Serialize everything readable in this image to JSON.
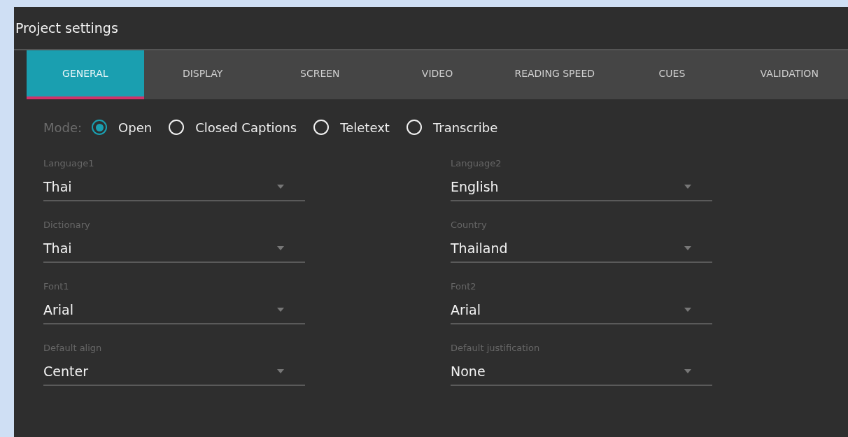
{
  "window": {
    "title": "Project settings"
  },
  "tabs": [
    {
      "label": "GENERAL",
      "selected": true
    },
    {
      "label": "DISPLAY",
      "selected": false
    },
    {
      "label": "SCREEN",
      "selected": false
    },
    {
      "label": "VIDEO",
      "selected": false
    },
    {
      "label": "READING SPEED",
      "selected": false
    },
    {
      "label": "CUES",
      "selected": false
    },
    {
      "label": "VALIDATION",
      "selected": false
    }
  ],
  "mode": {
    "label": "Mode:",
    "options": [
      {
        "label": "Open",
        "selected": true
      },
      {
        "label": "Closed Captions",
        "selected": false
      },
      {
        "label": "Teletext",
        "selected": false
      },
      {
        "label": "Transcribe",
        "selected": false
      }
    ]
  },
  "fields": [
    {
      "label": "Language1",
      "value": "Thai"
    },
    {
      "label": "Language2",
      "value": "English"
    },
    {
      "label": "Dictionary",
      "value": "Thai"
    },
    {
      "label": "Country",
      "value": "Thailand"
    },
    {
      "label": "Font1",
      "value": "Arial"
    },
    {
      "label": "Font2",
      "value": "Arial"
    },
    {
      "label": "Default align",
      "value": "Center"
    },
    {
      "label": "Default justification",
      "value": "None"
    }
  ]
}
